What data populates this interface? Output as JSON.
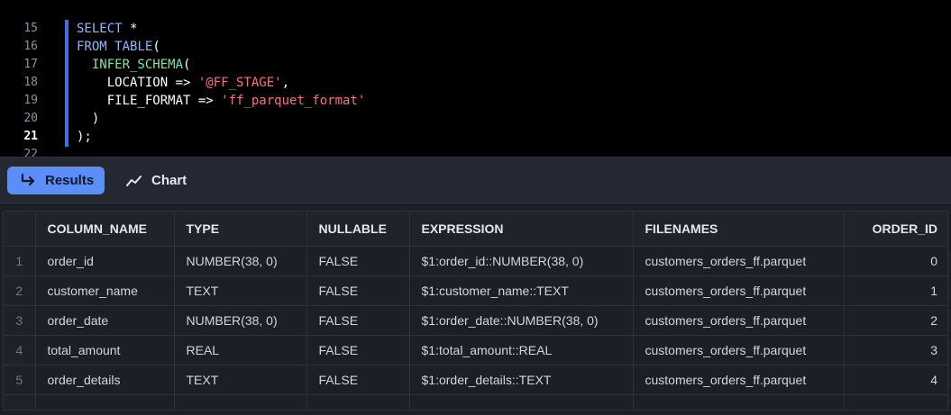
{
  "editor": {
    "lines": [
      {
        "number": "15",
        "tokens": [
          {
            "t": "SELECT ",
            "c": "kw"
          },
          {
            "t": "*",
            "c": "plain"
          }
        ]
      },
      {
        "number": "16",
        "tokens": [
          {
            "t": "FROM ",
            "c": "kw"
          },
          {
            "t": "TABLE",
            "c": "kw"
          },
          {
            "t": "(",
            "c": "plain"
          }
        ]
      },
      {
        "number": "17",
        "tokens": [
          {
            "t": "  ",
            "c": "plain"
          },
          {
            "t": "INFER_SCHEMA",
            "c": "fn"
          },
          {
            "t": "(",
            "c": "plain"
          }
        ]
      },
      {
        "number": "18",
        "tokens": [
          {
            "t": "    LOCATION => ",
            "c": "plain"
          },
          {
            "t": "'@FF_STAGE'",
            "c": "str"
          },
          {
            "t": ",",
            "c": "plain"
          }
        ]
      },
      {
        "number": "19",
        "tokens": [
          {
            "t": "    FILE_FORMAT => ",
            "c": "plain"
          },
          {
            "t": "'ff_parquet_format'",
            "c": "str"
          }
        ]
      },
      {
        "number": "20",
        "tokens": [
          {
            "t": "  )",
            "c": "plain"
          }
        ]
      },
      {
        "number": "21",
        "tokens": [
          {
            "t": ");",
            "c": "plain"
          }
        ],
        "active": true
      },
      {
        "number": "22",
        "tokens": []
      }
    ]
  },
  "toolbar": {
    "results_label": "Results",
    "chart_label": "Chart"
  },
  "colors": {
    "accent": "#5b8ef7",
    "keyword": "#8cb8ff",
    "function": "#7fe6a6",
    "string": "#ff6f7f"
  },
  "results_table": {
    "columns": [
      "",
      "COLUMN_NAME",
      "TYPE",
      "NULLABLE",
      "EXPRESSION",
      "FILENAMES",
      "ORDER_ID"
    ],
    "rows": [
      [
        "1",
        "order_id",
        "NUMBER(38, 0)",
        "FALSE",
        "$1:order_id::NUMBER(38, 0)",
        "customers_orders_ff.parquet",
        "0"
      ],
      [
        "2",
        "customer_name",
        "TEXT",
        "FALSE",
        "$1:customer_name::TEXT",
        "customers_orders_ff.parquet",
        "1"
      ],
      [
        "3",
        "order_date",
        "NUMBER(38, 0)",
        "FALSE",
        "$1:order_date::NUMBER(38, 0)",
        "customers_orders_ff.parquet",
        "2"
      ],
      [
        "4",
        "total_amount",
        "REAL",
        "FALSE",
        "$1:total_amount::REAL",
        "customers_orders_ff.parquet",
        "3"
      ],
      [
        "5",
        "order_details",
        "TEXT",
        "FALSE",
        "$1:order_details::TEXT",
        "customers_orders_ff.parquet",
        "4"
      ]
    ]
  }
}
